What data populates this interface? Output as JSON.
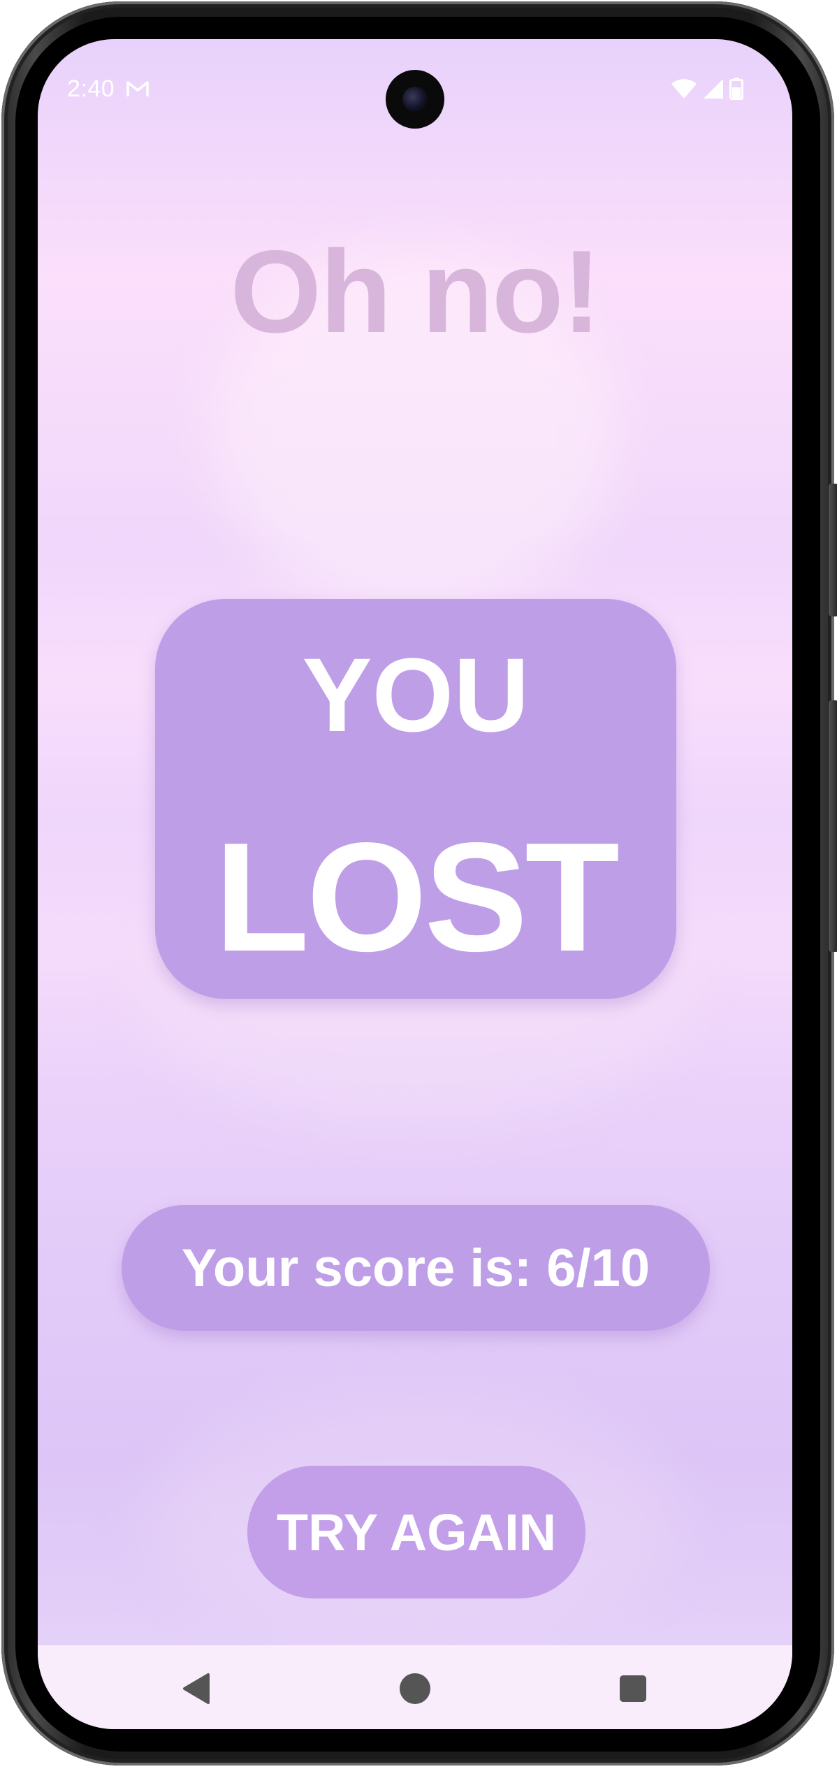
{
  "status_bar": {
    "time": "2:40",
    "icons": [
      "gmail-icon",
      "wifi-icon",
      "signal-icon",
      "battery-icon"
    ]
  },
  "screen": {
    "headline": "Oh no!",
    "result": {
      "line1": "YOU",
      "line2": "LOST"
    },
    "score_text": "Your score is: 6/10",
    "try_again_label": "TRY AGAIN"
  },
  "nav_bar": {
    "icons": [
      "back-icon",
      "home-icon",
      "recents-icon"
    ]
  },
  "colors": {
    "card": "#bf9ee8",
    "headline": "#d8b6dc",
    "text_on_card": "#ffffff",
    "nav_bar": "#f9edfc"
  }
}
